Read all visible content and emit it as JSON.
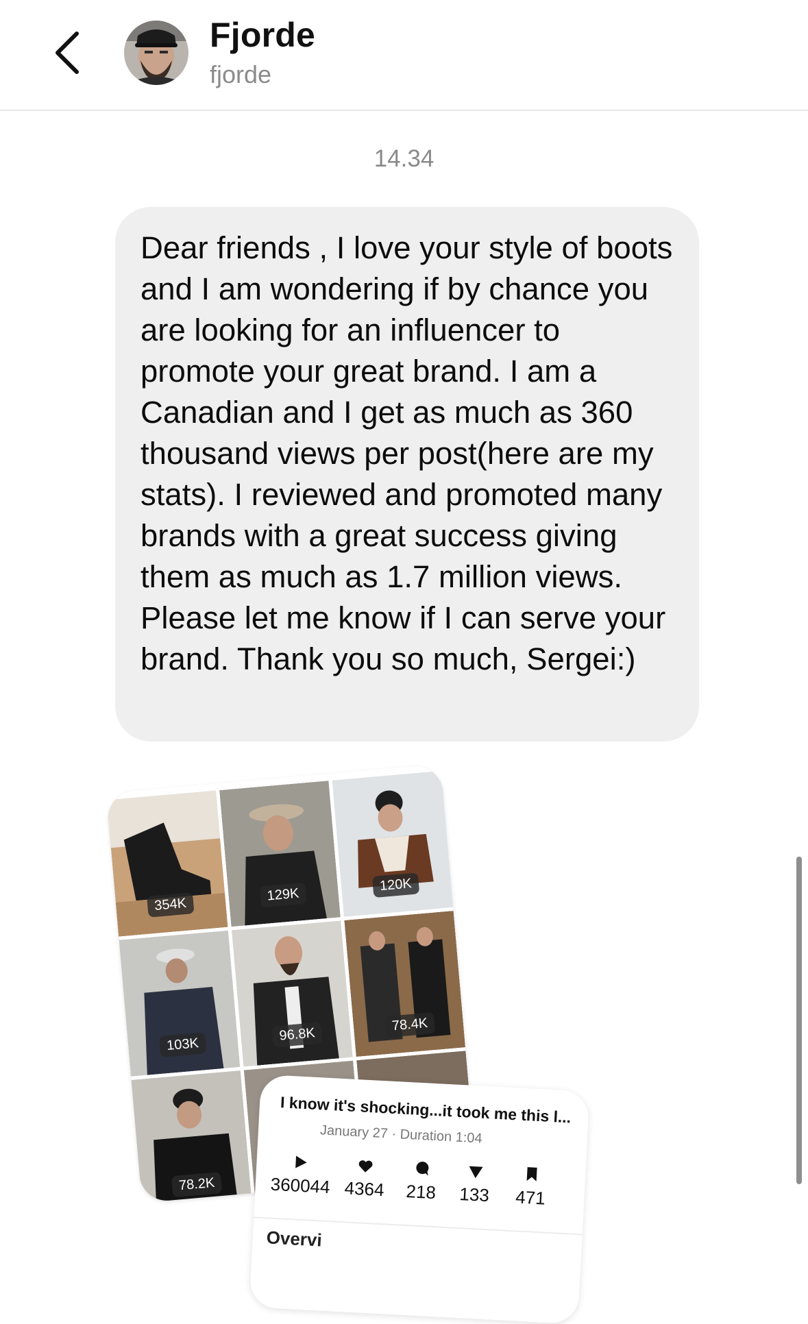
{
  "header": {
    "name": "Fjorde",
    "handle": "fjorde"
  },
  "conversation": {
    "timestamp": "14.34",
    "message": "Dear friends , I love your style of boots and I am wondering if by chance you are looking for an influencer to promote your great brand. I am a Canadian and I get as much as 360 thousand views per post(here are my stats). I reviewed and promoted many brands with a great success giving them as much as 1.7 million views. Please let me know if I can serve your brand. Thank you so much, Sergei:)"
  },
  "attachment": {
    "grid_views": [
      "354K",
      "129K",
      "120K",
      "103K",
      "96.8K",
      "78.4K",
      "78.2K",
      "",
      ""
    ],
    "post": {
      "title": "I know it's shocking...it took me this l...",
      "subtitle": "January 27 · Duration 1:04",
      "stats": [
        {
          "icon": "play-icon",
          "value": "360044"
        },
        {
          "icon": "heart-icon",
          "value": "4364"
        },
        {
          "icon": "comment-icon",
          "value": "218"
        },
        {
          "icon": "share-icon",
          "value": "133"
        },
        {
          "icon": "save-icon",
          "value": "471"
        }
      ],
      "section_partial": "Overvi"
    }
  },
  "colors": {
    "bubble": "#efefef",
    "timestamp": "#8a8a8a",
    "handle": "#8b8b8b"
  }
}
